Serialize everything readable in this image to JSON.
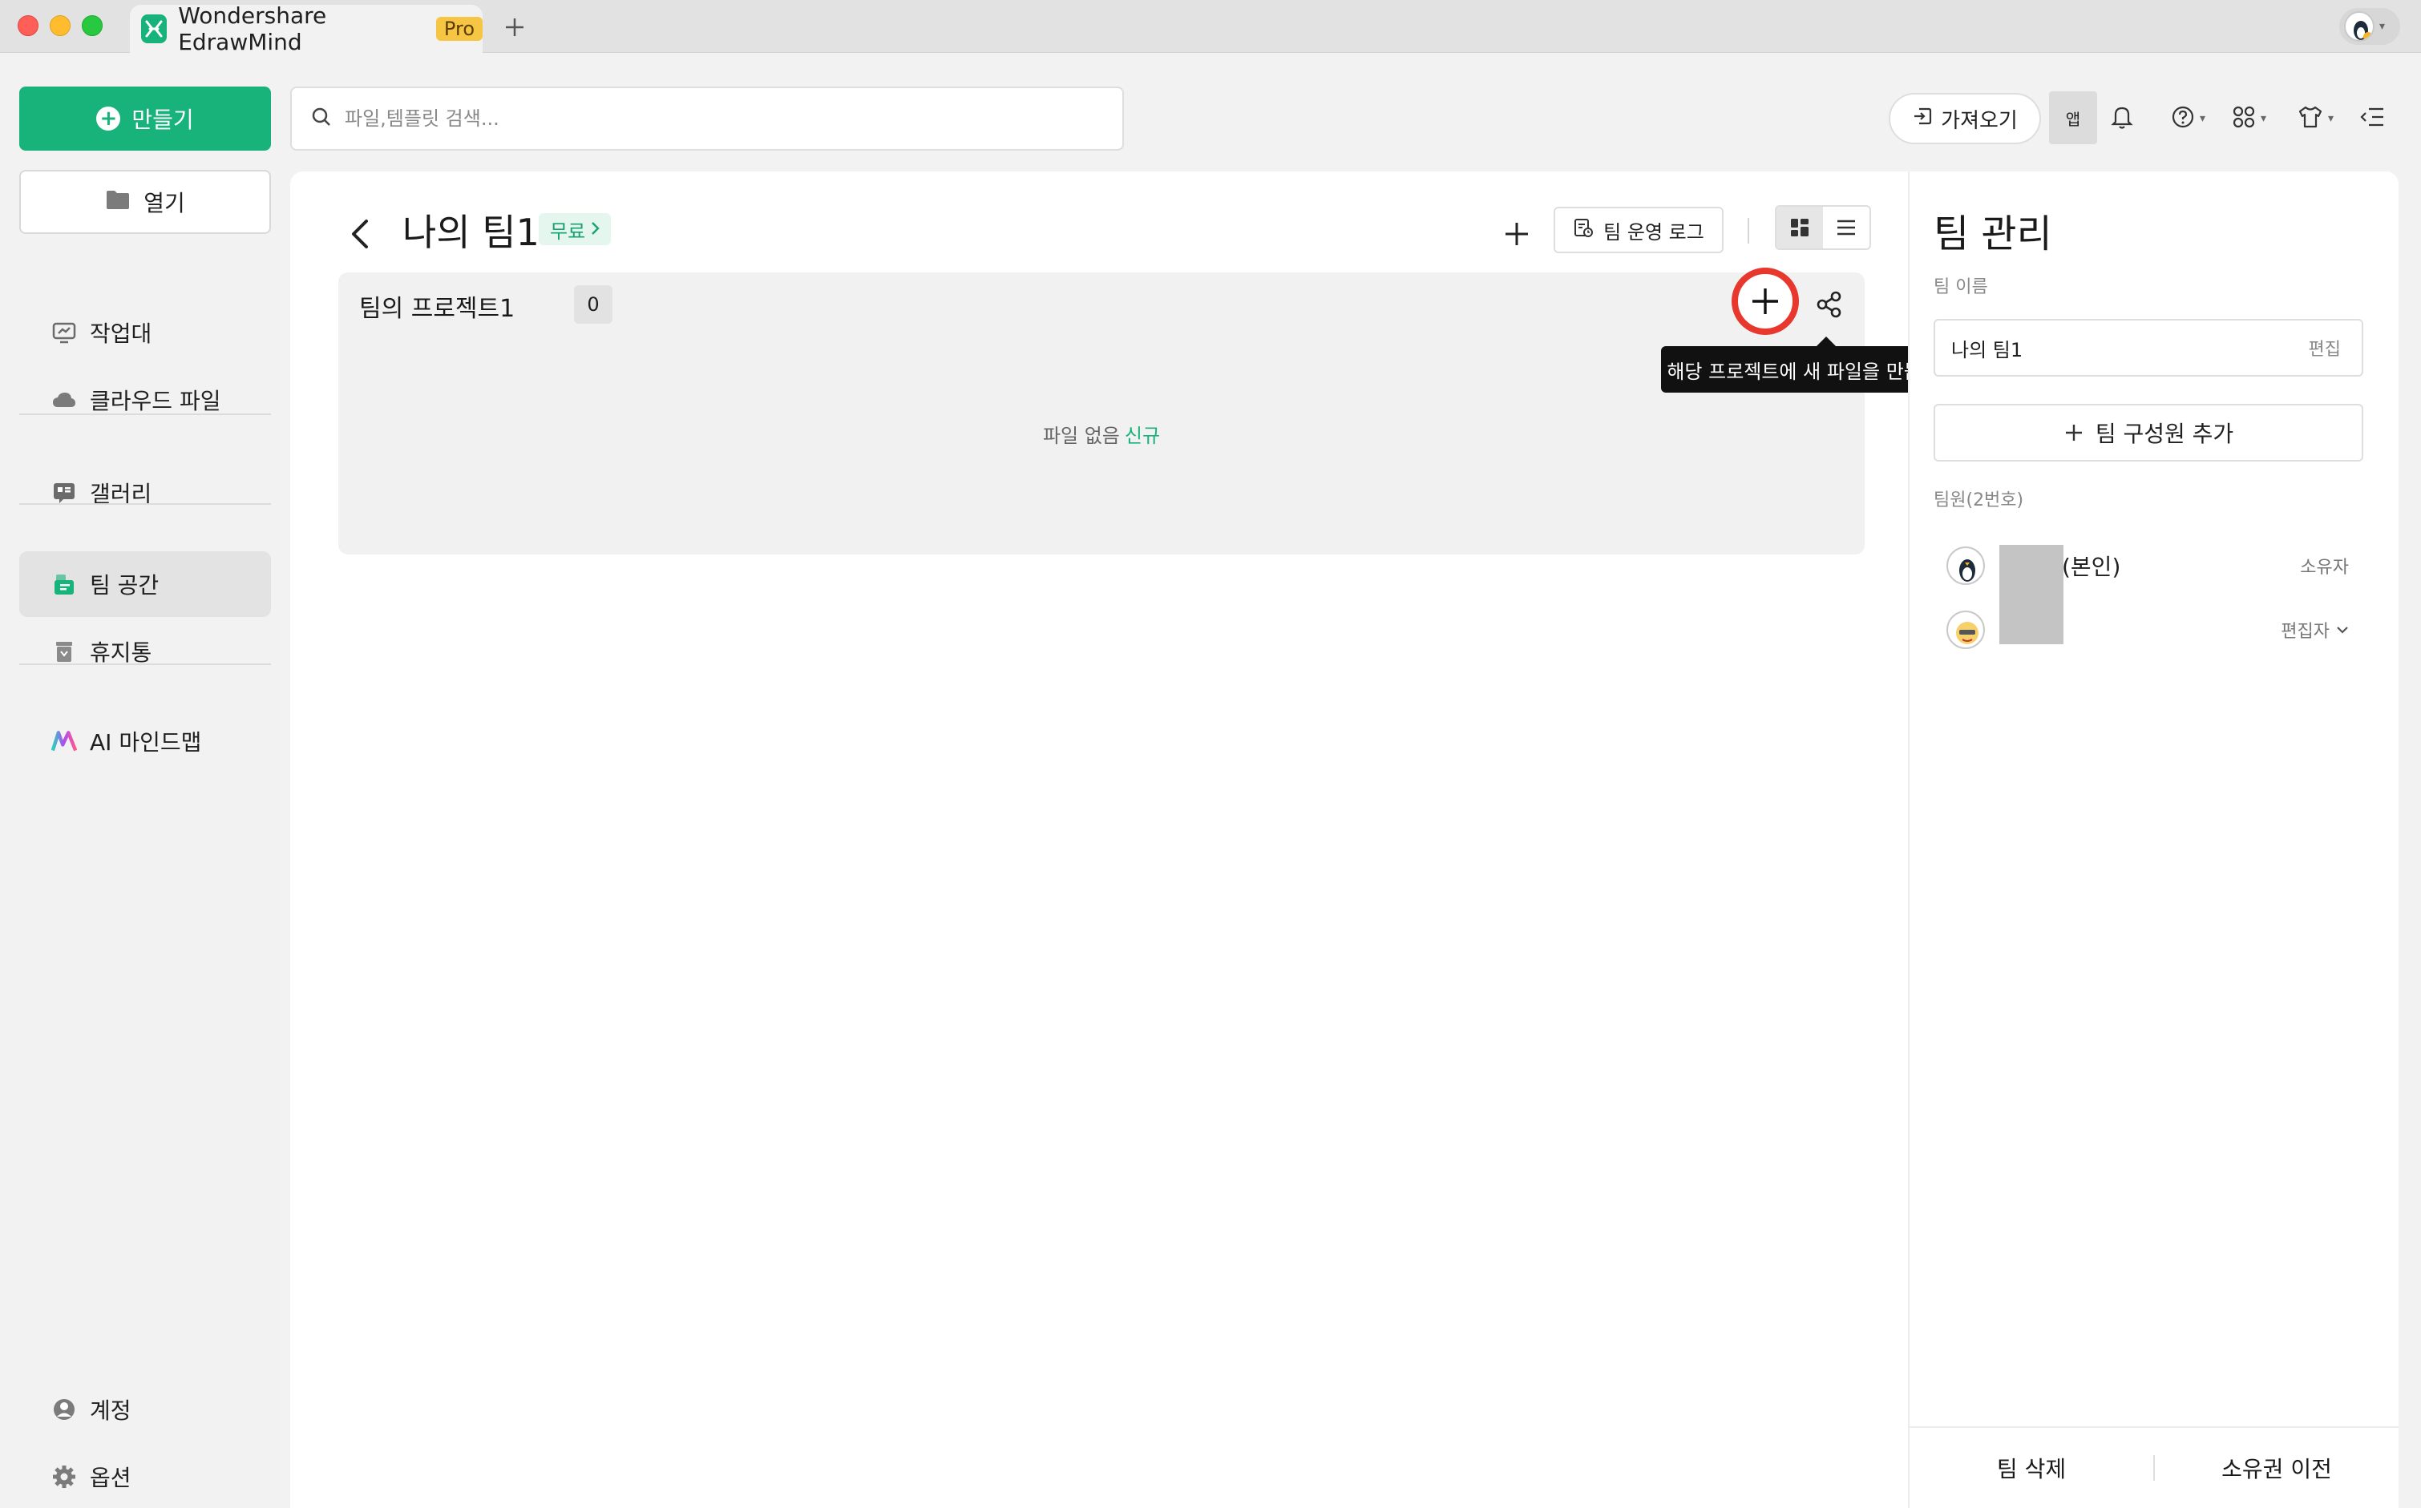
{
  "window": {
    "tab_title": "Wondershare EdrawMind",
    "tab_badge": "Pro"
  },
  "sidebar": {
    "create_label": "만들기",
    "open_label": "열기",
    "items": [
      {
        "label": "작업대",
        "icon": "workspace-icon"
      },
      {
        "label": "클라우드 파일",
        "icon": "cloud-icon"
      },
      {
        "label": "갤러리",
        "icon": "gallery-icon"
      },
      {
        "label": "팀 공간",
        "icon": "team-space-icon",
        "active": true
      },
      {
        "label": "휴지통",
        "icon": "trash-icon"
      },
      {
        "label": "AI 마인드맵",
        "icon": "ai-mindmap-icon"
      }
    ],
    "bottom": [
      {
        "label": "계정",
        "icon": "account-icon"
      },
      {
        "label": "옵션",
        "icon": "gear-icon"
      }
    ]
  },
  "toolbar": {
    "search_placeholder": "파일,템플릿 검색...",
    "import_label": "가져오기",
    "app_label": "앱"
  },
  "main": {
    "title": "나의 팀1",
    "plan_badge": "무료",
    "log_button": "팀 운영 로그",
    "project": {
      "name": "팀의 프로젝트1",
      "count": "0",
      "tooltip": "해당 프로젝트에 새 파일을 만듭니다.",
      "empty_text": "파일 없음",
      "empty_link": "신규"
    }
  },
  "team_panel": {
    "title": "팀 관리",
    "name_label": "팀 이름",
    "team_name": "나의 팀1",
    "edit_label": "편집",
    "add_member_label": "팀 구성원 추가",
    "members_label": "팀원(2번호)",
    "members": [
      {
        "name": "(본인)",
        "role": "소유자"
      },
      {
        "name": "",
        "role": "편집자"
      }
    ],
    "delete_team": "팀 삭제",
    "transfer_ownership": "소유권 이전"
  },
  "colors": {
    "brand_green": "#17b37a",
    "pro_badge": "#f7c544",
    "highlight_ring": "#e8382e"
  }
}
